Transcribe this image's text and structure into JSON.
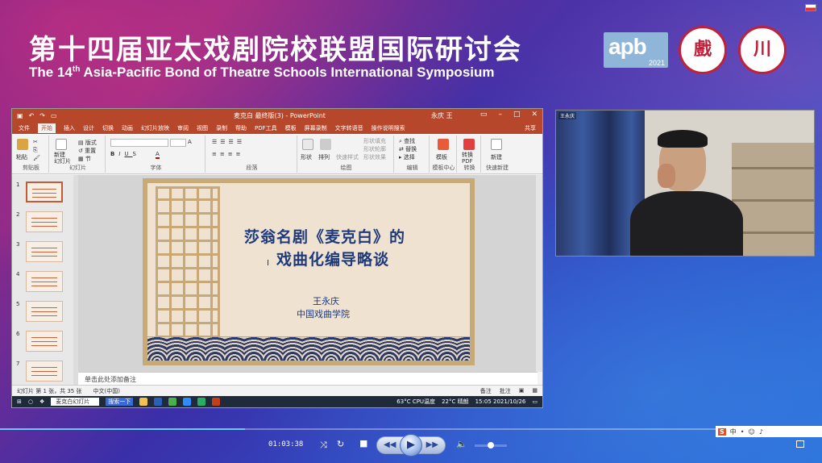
{
  "banner": {
    "title_cn": "第十四届亚太戏剧院校联盟国际研讨会",
    "title_en_pre": "The 14",
    "title_en_sup": "th",
    "title_en_post": " Asia-Pacific Bond of Theatre Schools International Symposium",
    "logo_apb": "apb",
    "logo_year": "2021",
    "seal1_icon": "shanghai-theatre-academy-seal",
    "seal2_icon": "sichuan-school-seal"
  },
  "ppt": {
    "window_title": "麦克白 最终版(3) - PowerPoint",
    "user": "永庆 王",
    "menu": [
      "文件",
      "开始",
      "插入",
      "设计",
      "切换",
      "动画",
      "幻灯片放映",
      "审阅",
      "视图",
      "录制",
      "帮助",
      "PDF工具",
      "模板",
      "屏幕录制",
      "文字转语音"
    ],
    "menu_selected": "开始",
    "tell_me": "操作说明搜索",
    "share": "共享",
    "ribbon": {
      "paste": "粘贴",
      "clipboard": "剪贴板",
      "new_slide": "新建\n幻灯片",
      "layout": "版式",
      "reset": "重置",
      "section": "节",
      "slides": "幻灯片",
      "font": "字体",
      "paragraph": "段落",
      "shapes": "形状",
      "arrange": "排列",
      "quick_styles": "快速样式",
      "shape_fill": "形状填充",
      "shape_outline": "形状轮廓",
      "shape_effects": "形状效果",
      "drawing": "绘图",
      "find": "查找",
      "replace": "替换",
      "select": "选择",
      "editing": "编辑",
      "template": "模板",
      "template_center": "模板中心",
      "convert_pdf": "转换\nPDF",
      "convert": "转换",
      "new": "新建",
      "quick_new": "快速新建"
    },
    "slide_numbers": [
      "1",
      "2",
      "3",
      "4",
      "5",
      "6",
      "7"
    ],
    "slide": {
      "title_line1": "莎翁名剧《麦克白》的",
      "title_line2": "戏曲化编导略谈",
      "author": "王永庆",
      "school": "中国戏曲学院"
    },
    "notes_placeholder": "单击此处添加备注",
    "status_left": "幻灯片 第 1 张，共 35 张",
    "status_lang": "中文(中国)",
    "status_notes": "备注",
    "status_comments": "批注"
  },
  "taskbar": {
    "search": "麦克白幻灯片",
    "search_btn": "搜索一下",
    "cpu_temp": "63°C",
    "cpu_label": "CPU温度",
    "weather": "22°C  晴朗",
    "time": "15:05",
    "date": "2021/10/26"
  },
  "cam": {
    "tag": "王永庆"
  },
  "player": {
    "elapsed": "01:03:38",
    "progress": 0.298,
    "volume": 0.5
  },
  "tray": {
    "items": [
      "中",
      "•",
      "☺",
      "♪"
    ]
  }
}
